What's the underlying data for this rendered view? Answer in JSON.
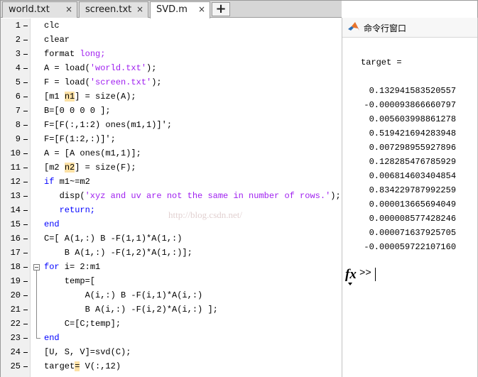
{
  "tabs": [
    {
      "label": "world.txt",
      "active": false
    },
    {
      "label": "screen.txt",
      "active": false
    },
    {
      "label": "SVD.m",
      "active": true
    }
  ],
  "tab_close_glyph": "×",
  "tab_add_glyph": "+",
  "editor": {
    "line_numbers": [
      "1",
      "2",
      "3",
      "4",
      "5",
      "6",
      "7",
      "8",
      "9",
      "10",
      "11",
      "12",
      "13",
      "14",
      "15",
      "16",
      "17",
      "18",
      "19",
      "20",
      "21",
      "22",
      "23",
      "24",
      "25"
    ],
    "lines": [
      [
        {
          "t": "clc"
        }
      ],
      [
        {
          "t": "clear"
        }
      ],
      [
        {
          "t": "format "
        },
        {
          "t": "long;",
          "c": "str"
        }
      ],
      [
        {
          "t": "A = load("
        },
        {
          "t": "'world.txt'",
          "c": "str"
        },
        {
          "t": ");"
        }
      ],
      [
        {
          "t": "F = load("
        },
        {
          "t": "'screen.txt'",
          "c": "str"
        },
        {
          "t": ");"
        }
      ],
      [
        {
          "t": "[m1 "
        },
        {
          "t": "n1",
          "c": "hl"
        },
        {
          "t": "] = size(A);"
        }
      ],
      [
        {
          "t": "B=[0 0 0 0 ];"
        }
      ],
      [
        {
          "t": "F=[F(:,1:2) ones(m1,1)]';"
        }
      ],
      [
        {
          "t": "F=[F(1:2,:)]';"
        }
      ],
      [
        {
          "t": "A = [A ones(m1,1)];"
        }
      ],
      [
        {
          "t": "[m2 "
        },
        {
          "t": "n2",
          "c": "hl"
        },
        {
          "t": "] = size(F);"
        }
      ],
      [
        {
          "t": "if",
          "c": "kw"
        },
        {
          "t": " m1~=m2"
        }
      ],
      [
        {
          "t": "   disp("
        },
        {
          "t": "'xyz and uv are not the same in number of rows.'",
          "c": "str"
        },
        {
          "t": ");"
        }
      ],
      [
        {
          "t": "   return;",
          "c": "kw"
        }
      ],
      [
        {
          "t": "end",
          "c": "kw"
        }
      ],
      [
        {
          "t": "C=[ A(1,:) B -F(1,1)*A(1,:)"
        }
      ],
      [
        {
          "t": "    B A(1,:) -F(1,2)*A(1,:)];"
        }
      ],
      [
        {
          "t": "for",
          "c": "kw"
        },
        {
          "t": " i= 2:m1"
        }
      ],
      [
        {
          "t": "    temp=["
        }
      ],
      [
        {
          "t": "        A(i,:) B -F(i,1)*A(i,:)"
        }
      ],
      [
        {
          "t": "        B A(i,:) -F(i,2)*A(i,:) ];"
        }
      ],
      [
        {
          "t": "    C=[C;temp];"
        }
      ],
      [
        {
          "t": "end",
          "c": "kw"
        }
      ],
      [
        {
          "t": "[U, S, V]=svd(C);"
        }
      ],
      [
        {
          "t": "target"
        },
        {
          "t": "=",
          "c": "hl"
        },
        {
          "t": " V(:,12)"
        }
      ]
    ],
    "watermark": "http://blog.csdn.net/"
  },
  "command_window": {
    "title": "命令行窗口",
    "output_header": "target =",
    "values": [
      "   0.132941583520557",
      "  -0.000093866660797",
      "   0.005603998861278",
      "   0.519421694283948",
      "   0.007298955927896",
      "   0.128285476785929",
      "   0.006814603404854",
      "   0.834229787992259",
      "   0.000013665694049",
      "   0.000008577428246",
      "   0.000071637925705",
      "  -0.000059722107160"
    ],
    "prompt_fx": "fx",
    "prompt": ">>"
  },
  "colors": {
    "keyword": "#0000ff",
    "string": "#a020f0",
    "highlight": "#fde2a6"
  }
}
